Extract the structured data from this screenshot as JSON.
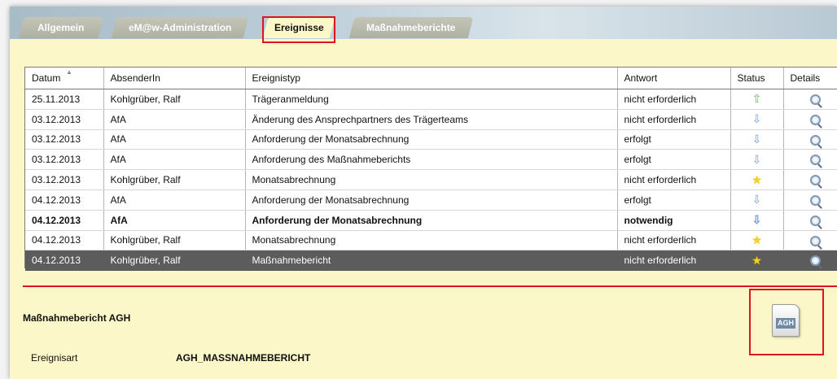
{
  "tabs": [
    {
      "label": "Allgemein",
      "active": false
    },
    {
      "label": "eM@w-Administration",
      "active": false
    },
    {
      "label": "Ereignisse",
      "active": true
    },
    {
      "label": "Maßnahmeberichte",
      "active": false
    }
  ],
  "table": {
    "columns": [
      "Datum",
      "AbsenderIn",
      "Ereignistyp",
      "Antwort",
      "Status",
      "Details"
    ],
    "rows": [
      {
        "datum": "25.11.2013",
        "absender": "Kohlgrüber, Ralf",
        "typ": "Trägeranmeldung",
        "antwort": "nicht erforderlich",
        "status": "arrow-up",
        "bold": false,
        "selected": false
      },
      {
        "datum": "03.12.2013",
        "absender": "AfA",
        "typ": "Änderung des Ansprechpartners des Trägerteams",
        "antwort": "nicht erforderlich",
        "status": "arrow-down",
        "bold": false,
        "selected": false
      },
      {
        "datum": "03.12.2013",
        "absender": "AfA",
        "typ": "Anforderung der Monatsabrechnung",
        "antwort": "erfolgt",
        "status": "arrow-down",
        "bold": false,
        "selected": false
      },
      {
        "datum": "03.12.2013",
        "absender": "AfA",
        "typ": "Anforderung des Maßnahmeberichts",
        "antwort": "erfolgt",
        "status": "arrow-down",
        "bold": false,
        "selected": false
      },
      {
        "datum": "03.12.2013",
        "absender": "Kohlgrüber, Ralf",
        "typ": "Monatsabrechnung",
        "antwort": "nicht erforderlich",
        "status": "star",
        "bold": false,
        "selected": false
      },
      {
        "datum": "04.12.2013",
        "absender": "AfA",
        "typ": "Anforderung der Monatsabrechnung",
        "antwort": "erfolgt",
        "status": "arrow-down",
        "bold": false,
        "selected": false
      },
      {
        "datum": "04.12.2013",
        "absender": "AfA",
        "typ": "Anforderung der Monatsabrechnung",
        "antwort": "notwendig",
        "status": "arrow-down",
        "bold": true,
        "selected": false
      },
      {
        "datum": "04.12.2013",
        "absender": "Kohlgrüber, Ralf",
        "typ": "Monatsabrechnung",
        "antwort": "nicht erforderlich",
        "status": "star",
        "bold": false,
        "selected": false
      },
      {
        "datum": "04.12.2013",
        "absender": "Kohlgrüber, Ralf",
        "typ": "Maßnahmebericht",
        "antwort": "nicht erforderlich",
        "status": "star",
        "bold": false,
        "selected": true
      }
    ]
  },
  "detail": {
    "title": "Maßnahmebericht AGH",
    "icon_label": "AGH",
    "field_label": "Ereignisart",
    "field_value": "AGH_MASSNAHMEBERICHT"
  },
  "colors": {
    "highlight": "#e0141e",
    "panel": "#fbf7c9",
    "selected_row": "#5c5c5c"
  }
}
